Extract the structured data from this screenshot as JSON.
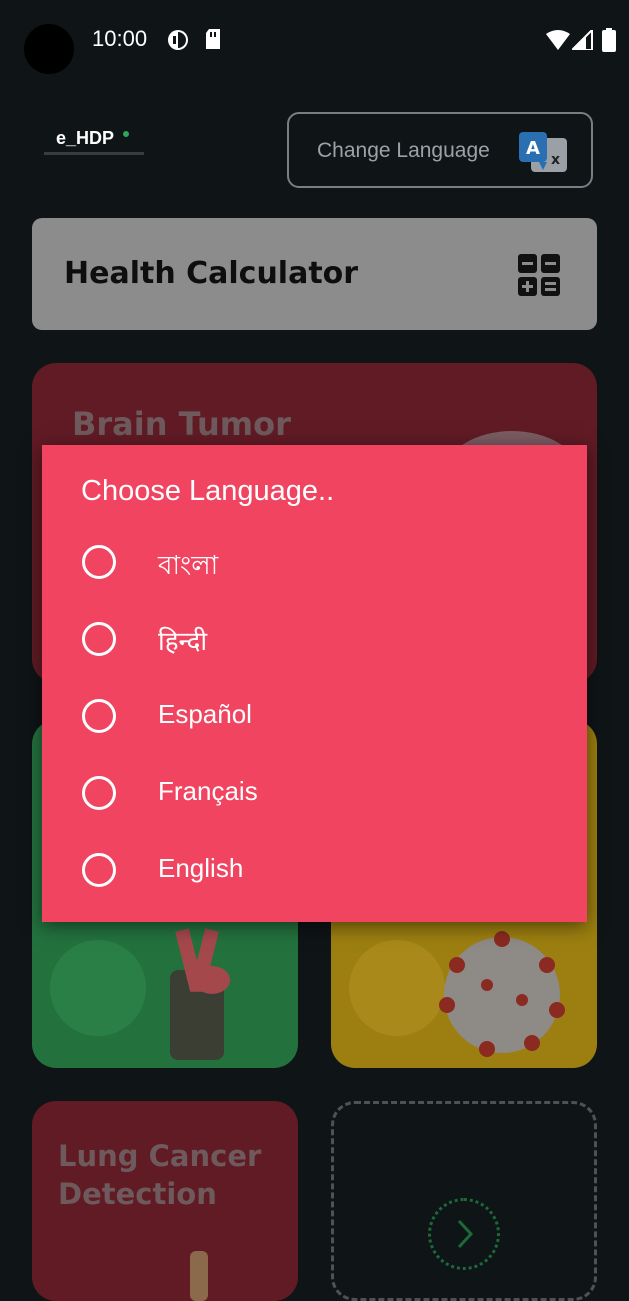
{
  "status_bar": {
    "time": "10:00"
  },
  "header": {
    "logo_text": "e_HDP",
    "change_language_label": "Change Language"
  },
  "health_calculator": {
    "title": "Health Calculator"
  },
  "cards": {
    "brain_tumor": {
      "title": "Brain Tumor"
    },
    "lung_cancer": {
      "title": "Lung Cancer Detection"
    }
  },
  "dialog": {
    "title": "Choose Language..",
    "options": [
      {
        "label": "বাংলা",
        "selected": false
      },
      {
        "label": "हिन्दी",
        "selected": false
      },
      {
        "label": "Español",
        "selected": false
      },
      {
        "label": "Français",
        "selected": false
      },
      {
        "label": "English",
        "selected": false
      }
    ]
  },
  "colors": {
    "background": "#0f1417",
    "dialog": "#f04460",
    "brain_card": "#611b25",
    "green_card": "#23723e",
    "yellow_card": "#9c7f10"
  }
}
